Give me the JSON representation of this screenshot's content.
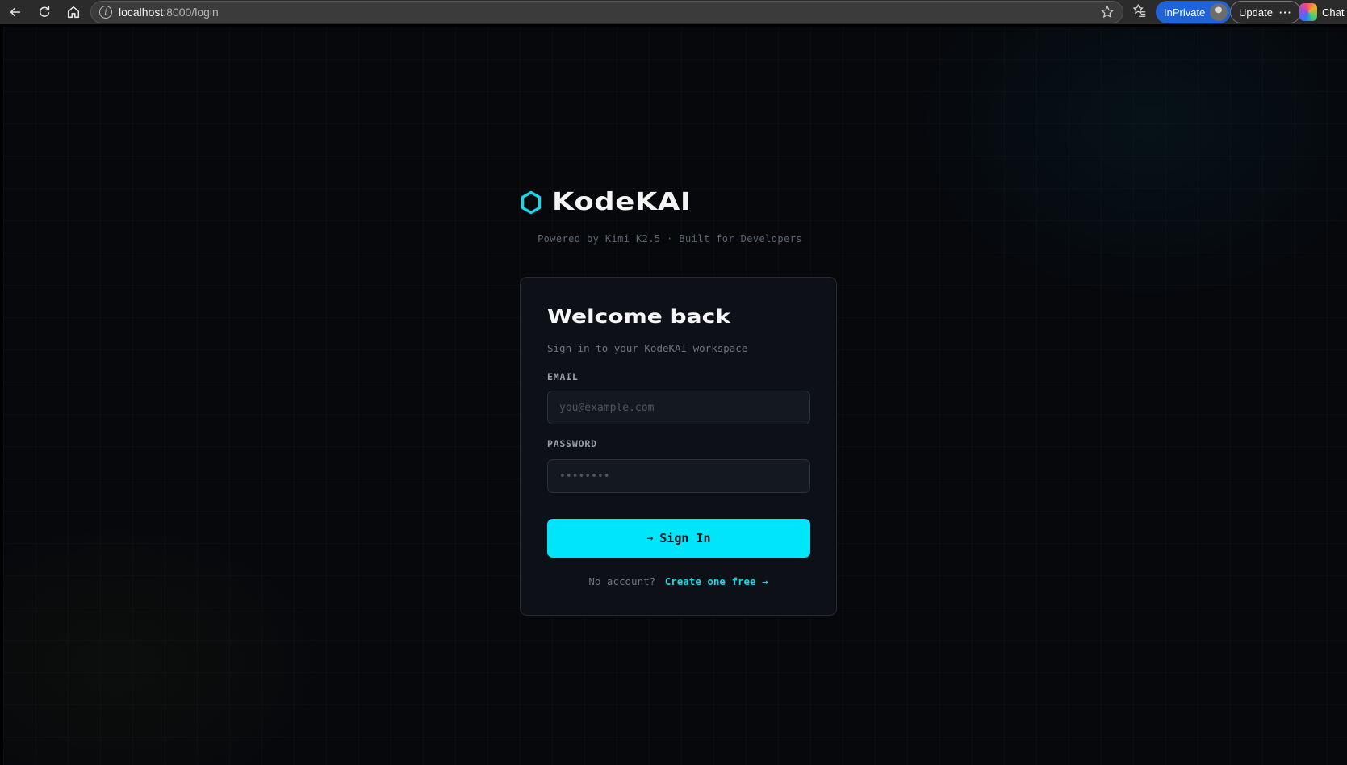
{
  "browser": {
    "url_host": "localhost",
    "url_path": ":8000/login",
    "inprivate_label": "InPrivate",
    "update_label": "Update",
    "update_more": "···",
    "chat_label": "Chat"
  },
  "brand": {
    "name": "KodeKAI",
    "tagline": "Powered by Kimi K2.5 · Built for Developers",
    "accent_color": "#00e5fa"
  },
  "login": {
    "title": "Welcome back",
    "subtitle": "Sign in to your KodeKAI workspace",
    "email_label": "EMAIL",
    "email_placeholder": "you@example.com",
    "email_value": "",
    "password_label": "PASSWORD",
    "password_placeholder": "••••••••",
    "password_value": "",
    "submit_arrow": "→",
    "submit_label": "Sign In",
    "signup_prompt": "No account?",
    "signup_link": "Create one free →"
  }
}
